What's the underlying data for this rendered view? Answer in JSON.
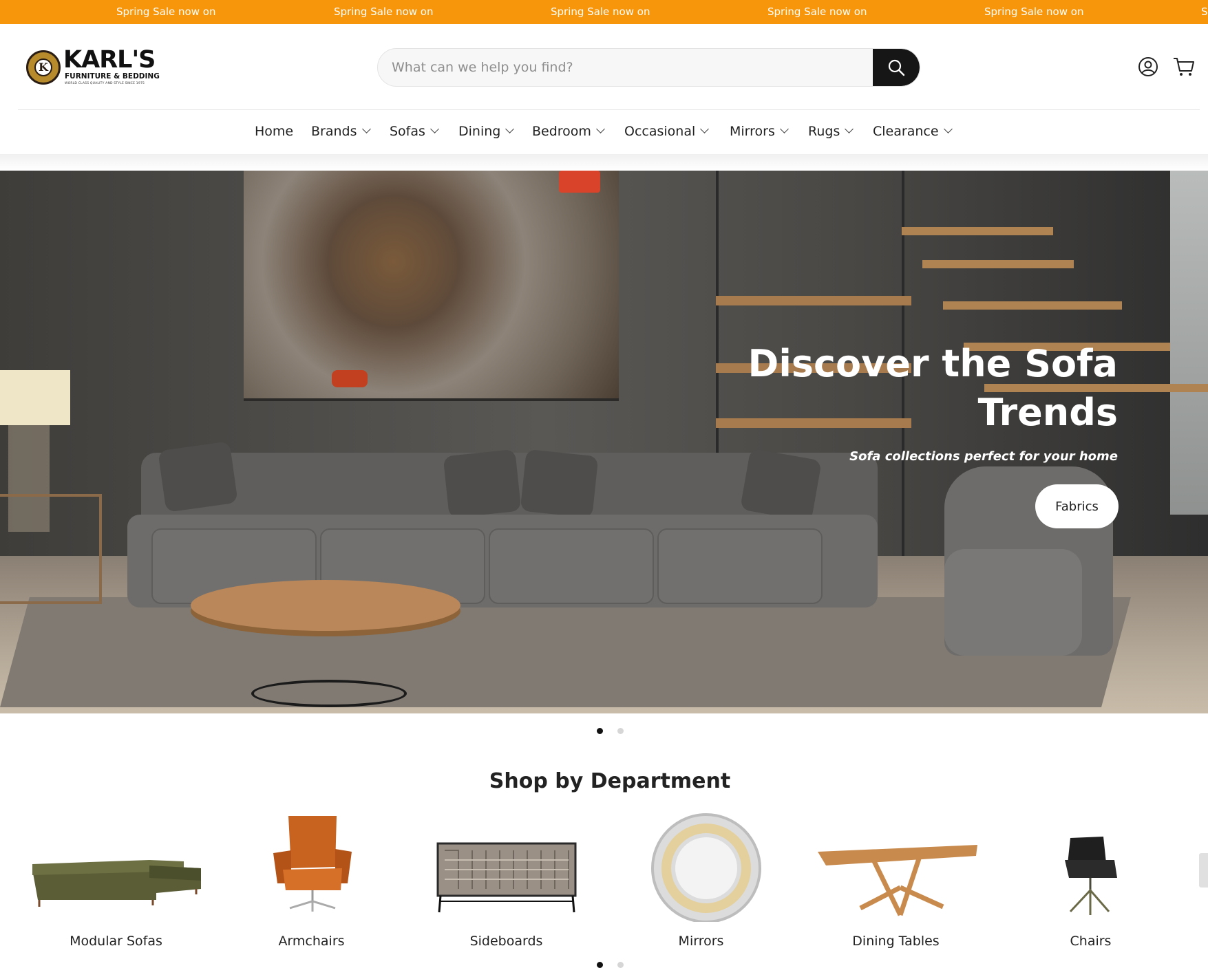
{
  "announcement": {
    "items": [
      "Spring Sale now on",
      "Spring Sale now on",
      "Spring Sale now on",
      "Spring Sale now on",
      "Spring Sale now on",
      "S"
    ],
    "color": "#f7960b"
  },
  "header": {
    "logo": {
      "name": "KARL'S",
      "sub": "FURNITURE & BEDDING",
      "tagline": "WORLD CLASS QUALITY AND STYLE SINCE 1975",
      "emblem_letter": "K"
    },
    "search": {
      "placeholder": "What can we help you find?",
      "icon": "search-icon"
    },
    "account_icon": "account-icon",
    "cart_icon": "cart-icon"
  },
  "nav": {
    "items": [
      {
        "label": "Home",
        "has_dropdown": false
      },
      {
        "label": "Brands",
        "has_dropdown": true
      },
      {
        "label": "Sofas",
        "has_dropdown": true
      },
      {
        "label": "Dining",
        "has_dropdown": true
      },
      {
        "label": "Bedroom",
        "has_dropdown": true
      },
      {
        "label": "Occasional",
        "has_dropdown": true
      },
      {
        "label": "Mirrors",
        "has_dropdown": true
      },
      {
        "label": "Rugs",
        "has_dropdown": true
      },
      {
        "label": "Clearance",
        "has_dropdown": true
      }
    ]
  },
  "hero": {
    "title": "Discover the Sofa Trends",
    "subtitle": "Sofa collections perfect for your home",
    "cta_label": "Fabrics",
    "slides_total": 2,
    "active_slide": 1
  },
  "departments": {
    "heading": "Shop by Department",
    "items": [
      {
        "label": "Modular Sofas"
      },
      {
        "label": "Armchairs"
      },
      {
        "label": "Sideboards"
      },
      {
        "label": "Mirrors"
      },
      {
        "label": "Dining Tables"
      },
      {
        "label": "Chairs"
      }
    ],
    "pages_total": 2,
    "active_page": 1
  }
}
